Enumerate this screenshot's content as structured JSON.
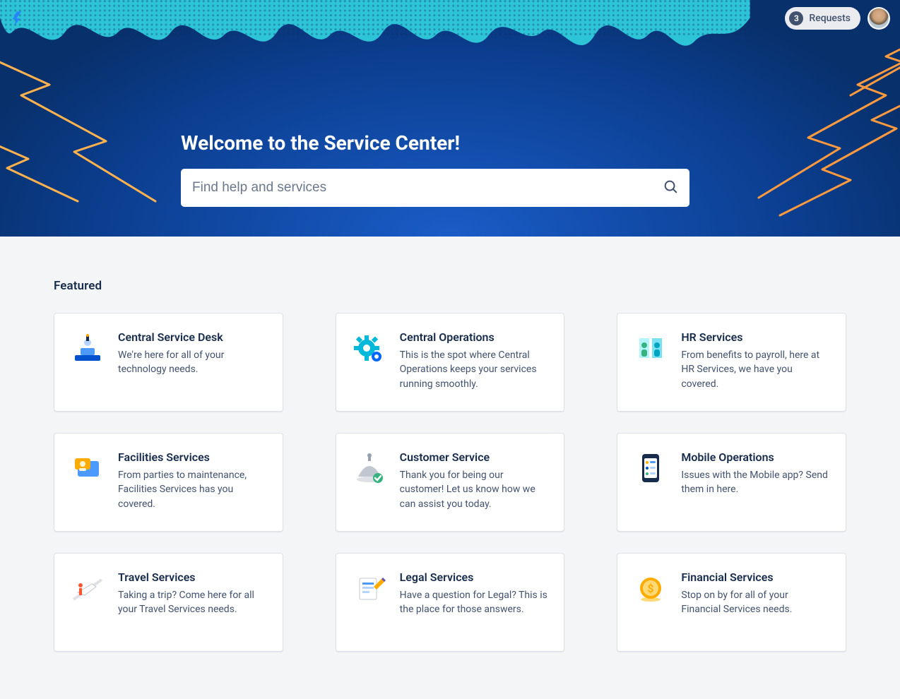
{
  "topbar": {
    "requests_count": "3",
    "requests_label": "Requests"
  },
  "hero": {
    "title": "Welcome to the Service Center!"
  },
  "search": {
    "placeholder": "Find help and services"
  },
  "section": {
    "title": "Featured"
  },
  "cards": [
    {
      "title": "Central Service Desk",
      "desc": "We're here for all of your technology needs.",
      "icon": "service-desk-icon"
    },
    {
      "title": "Central Operations",
      "desc": "This is the spot where Central Operations keeps your services running smoothly.",
      "icon": "operations-gear-icon"
    },
    {
      "title": "HR Services",
      "desc": "From benefits to payroll, here at HR Services, we have you covered.",
      "icon": "hr-people-icon"
    },
    {
      "title": "Facilities Services",
      "desc": "From parties to maintenance, Facilities Services has you covered.",
      "icon": "facilities-card-icon"
    },
    {
      "title": "Customer Service",
      "desc": "Thank you for being our customer! Let us know how we can assist you today.",
      "icon": "customer-tray-icon"
    },
    {
      "title": "Mobile Operations",
      "desc": "Issues with the Mobile app? Send them in here.",
      "icon": "mobile-phone-icon"
    },
    {
      "title": "Travel Services",
      "desc": "Taking a trip? Come here for all your Travel Services needs.",
      "icon": "travel-plane-icon"
    },
    {
      "title": "Legal Services",
      "desc": "Have a question for Legal? This is the place for those answers.",
      "icon": "legal-doc-icon"
    },
    {
      "title": "Financial Services",
      "desc": "Stop on by for all of your Financial Services needs.",
      "icon": "financial-coin-icon"
    }
  ],
  "icon_colors": {
    "service-desk-icon": "#0052cc",
    "operations-gear-icon": "#00b8d9",
    "hr-people-icon": "#36b37e",
    "facilities-card-icon": "#ffab00",
    "customer-tray-icon": "#c1c7d0",
    "mobile-phone-icon": "#0052cc",
    "travel-plane-icon": "#ff5630",
    "legal-doc-icon": "#6554c0",
    "financial-coin-icon": "#ffab00"
  }
}
